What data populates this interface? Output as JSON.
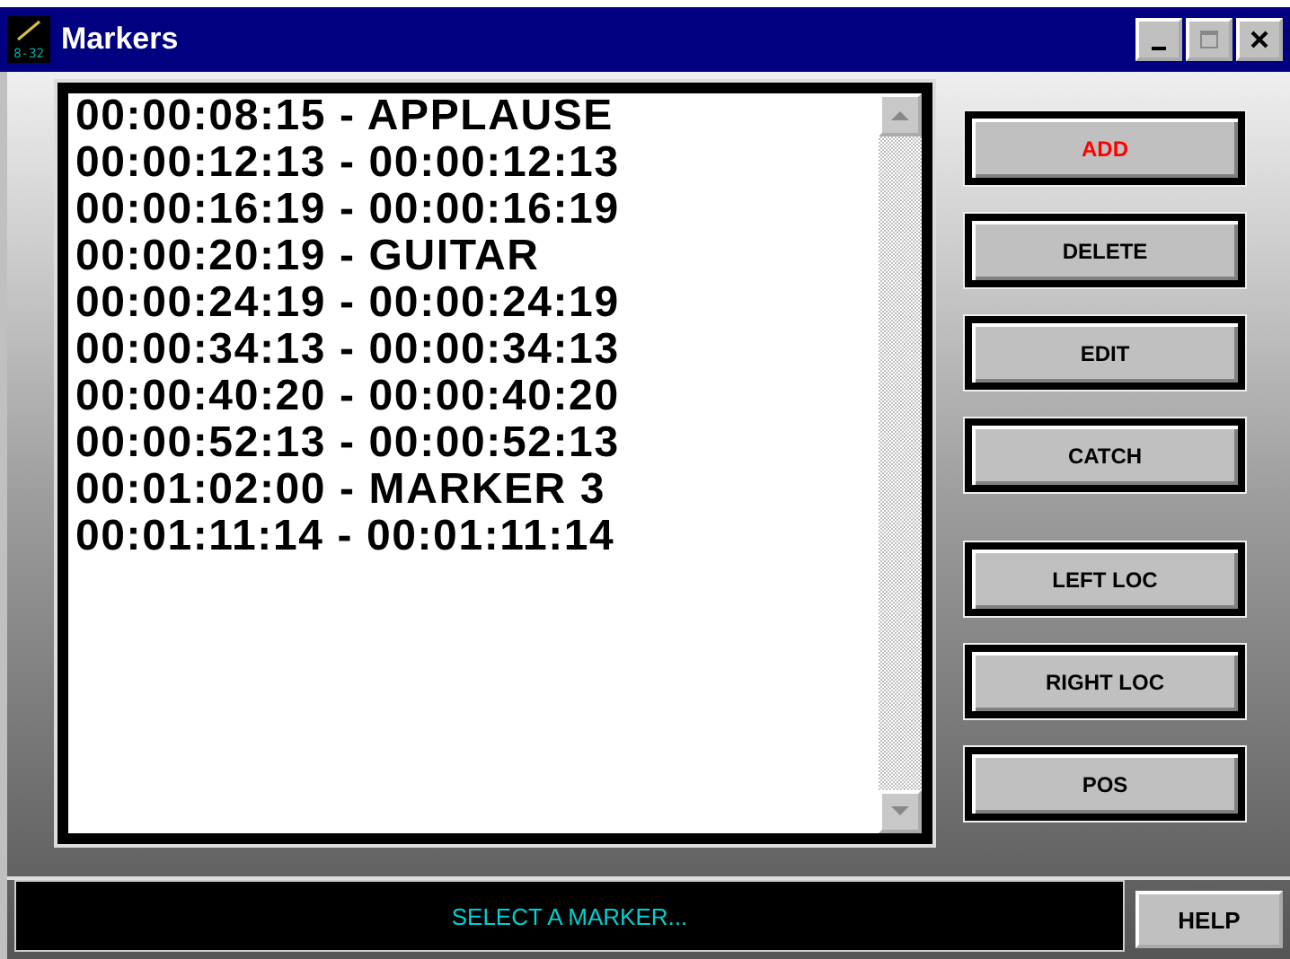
{
  "window": {
    "title": "Markers",
    "icon_text": "8-32"
  },
  "markers": [
    "00:00:08:15 - APPLAUSE",
    "00:00:12:13 - 00:00:12:13",
    "00:00:16:19 - 00:00:16:19",
    "00:00:20:19 - GUITAR",
    "00:00:24:19 - 00:00:24:19",
    "00:00:34:13 - 00:00:34:13",
    "00:00:40:20 - 00:00:40:20",
    "00:00:52:13 - 00:00:52:13",
    "00:01:02:00 - MARKER 3",
    "00:01:11:14 - 00:01:11:14"
  ],
  "edit_buttons": [
    {
      "label": "ADD",
      "highlighted": true
    },
    {
      "label": "DELETE",
      "highlighted": false
    },
    {
      "label": "EDIT",
      "highlighted": false
    },
    {
      "label": "CATCH",
      "highlighted": false
    }
  ],
  "locate_buttons": [
    {
      "label": "LEFT LOC",
      "highlighted": false
    },
    {
      "label": "RIGHT LOC",
      "highlighted": false
    },
    {
      "label": "POS",
      "highlighted": false
    }
  ],
  "status": "SELECT A MARKER...",
  "help_button": "HELP"
}
